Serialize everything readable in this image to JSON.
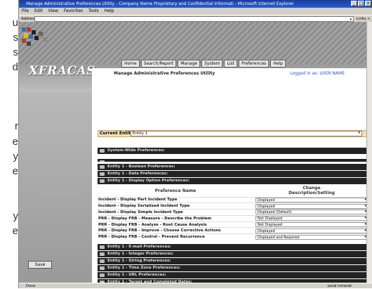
{
  "left_fragments": [
    "u",
    "s",
    "s",
    "d",
    "r",
    "e",
    "y",
    "e",
    "y",
    "e"
  ],
  "window": {
    "title": "Manage Administrative Preferences Utility - Company Name Proprietary and Confidential Informati - Microsoft Internet Explorer",
    "buttons": [
      "_",
      "□",
      "×"
    ]
  },
  "menu": [
    "File",
    "Edit",
    "View",
    "Favorites",
    "Tools",
    "Help"
  ],
  "address": {
    "label": "Address",
    "links": "Links »"
  },
  "logo": "XFRACAS",
  "nav": [
    "Home",
    "Search/Report",
    "Manage",
    "System",
    "List",
    "Preferences",
    "Help"
  ],
  "page_title": "Manage Administrative Preferences Utility",
  "logged_in": "Logged in as: USER NAME",
  "current_entity": {
    "label": "Current Entity:",
    "value": "Entity 1"
  },
  "sections_top": [
    "System-Wide Preferences:"
  ],
  "sections_entity": [
    "Entity 1 - Boolean Preferences:",
    "Entity 1 - Date Preferences:",
    "Entity 1 - Display Option Preferences:"
  ],
  "table": {
    "col1": "Preference Name",
    "col2_line1": "Change",
    "col2_line2": "Description/Setting",
    "rows": [
      {
        "name": "Incident - Display Part Incident Type",
        "value": "Displayed"
      },
      {
        "name": "Incident - Display Serialized Incident Type",
        "value": "Displayed"
      },
      {
        "name": "Incident - Display Simple Incident Type",
        "value": "Displayed (Default)"
      },
      {
        "name": "PRR - Display FRB - Measure - Describe the Problem",
        "value": "Not Displayed"
      },
      {
        "name": "PRR - Display FRB - Analyze - Root Cause Analysis",
        "value": "Not Displayed"
      },
      {
        "name": "PRR - Display FRB - Improve - Choose Corrective Actions",
        "value": "Displayed"
      },
      {
        "name": "PRR - Display FRB - Control - Prevent Recurrence",
        "value": "Displayed and Required"
      }
    ]
  },
  "sections_bottom": [
    "Entity 1 - E-mail Preferences:",
    "Entity 1 - Integer Preferences:",
    "Entity 1 - String Preferences:",
    "Entity 1 - Time Zone Preferences:",
    "Entity 1 - URL Preferences:",
    "Entity 1 - Target and Completed Dates:"
  ],
  "save_label": "Save",
  "status": {
    "left": "Done",
    "right": "Local intranet"
  }
}
